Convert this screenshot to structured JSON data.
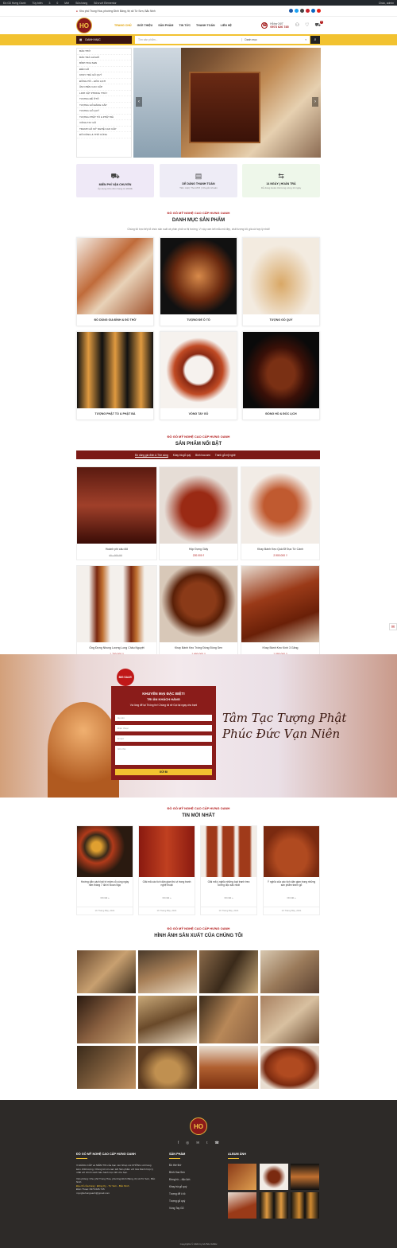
{
  "adminbar": {
    "items": [
      "Đồ Gỗ Hưng Oanh",
      "Tùy biến",
      "3",
      "0",
      "Mới",
      "Sửa trang",
      "Sửa với Elementor"
    ],
    "right": "Chào, admin"
  },
  "topbar": {
    "address": "Khu phố Trung Hòa, phường Đình Bảng, thị xã Từ Sơn, Bắc Ninh",
    "social_icons": [
      "facebook-icon",
      "twitter-icon",
      "email-icon",
      "pinterest-icon",
      "linkedin-icon",
      "youtube-icon"
    ]
  },
  "header": {
    "logo_text": "HO",
    "nav": [
      "TRANG CHỦ",
      "GIỚI THIỆU",
      "SẢN PHẨM",
      "TIN TỨC",
      "THANH TOÁN",
      "LIÊN HỆ"
    ],
    "hotline_label": "Hỗ trợ 24/7",
    "hotline_number": "0973 626 745",
    "cart_count": "0"
  },
  "search": {
    "category_label": "DANH MỤC",
    "placeholder": "Tìm sản phẩm...",
    "select_value": "Danh mục"
  },
  "categories": [
    "BÀN THỜ",
    "BÁN TRÀ GIÁ ĐỖ",
    "BÌNH HOA SEN",
    "ĐÈN GỖ",
    "KHAY TRÀ GỖ QUÝ",
    "ĐỒNG HỒ – ĐỒC LỊCH",
    "ÂM CHÉN CAO CẤP",
    "LINH VẬT PHONG THỦY",
    "TƯỢNG ĐỂ ÔTÔ",
    "TƯỢNG GỖ ĐĂNG CẤP",
    "TƯỢNG GỖ QUÝ",
    "TƯỢNG PHẬT TỔ & PHẬT BÀ",
    "VÒNG TAY GỖ",
    "TRANH GỖ MỸ NGHỆ CAO CẤP",
    "ĐỒ DÙNG & THỜ CÚNG"
  ],
  "features": [
    {
      "icon": "truck-icon",
      "title": "MIỄN PHÍ VẬN CHUYỂN",
      "sub": "Áp dụng Cho đơn hàng từ 2000k",
      "bg": "#efe9f7"
    },
    {
      "icon": "payment-icon",
      "title": "DỄ DÀNG THANH TOÁN",
      "sub": "Tiền mặt | Thẻ ATM | Chuyển khoản",
      "bg": "#eeecf6"
    },
    {
      "icon": "return-icon",
      "title": "14 NGÀY | HOÀN TRẢ",
      "sub": "Dễ dàng Hoàn trả trong vòng 14 ngày",
      "bg": "#eef7ea"
    }
  ],
  "categories_section": {
    "sub": "ĐỒ GỖ MỸ NGHỆ CAO CẤP HƯNG OANH",
    "title": "DANH MỤC SẢN PHẨM",
    "desc": "Chúng tôi trực tiếp tổ chức sản xuất và phân phối ra thị trường. Vì vậy cam kết mẫu mã đẹp, chất lượng tốt, giá cả hợp lý nhất!",
    "items": [
      "ĐỒ DÙNG GIA ĐÌNH & ĐỒ THỜ",
      "TƯỢNG ĐỂ Ô TÔ",
      "TƯỢNG GỖ QUÝ",
      "TƯỢNG PHẬT TỔ & PHẬT BÀ",
      "VÒNG TAY GỖ",
      "ĐỒNG HỒ & ĐỐC LỊCH"
    ]
  },
  "featured_section": {
    "sub": "ĐỒ GỖ MỸ NGHỆ CAO CẤP HƯNG OANH",
    "title": "SẢN PHẨM NỔI BẬT",
    "tabs": [
      "Đồ dùng gia đình & Thờ cúng",
      "Khay trà gỗ quý",
      "Bình hoa sen",
      "Tranh gỗ mỹ nghệ"
    ],
    "products": [
      {
        "name": "Hoành phi câu đối",
        "old": "46 - 991.98",
        "price": ""
      },
      {
        "name": "Hộp Đựng Giấy",
        "old": "",
        "price": "220.000 ₫"
      },
      {
        "name": "Khay Bánh Kẹo Quả Đỉ Đục Tứ Cánh",
        "old": "",
        "price": "2.900.000 ₫"
      },
      {
        "name": "Ống Đựng Nhung Lượng Long Châu Nguyệt",
        "old": "",
        "price": "1.700.000 ₫"
      },
      {
        "name": "Khay Bánh Kẹo Tròng Đồng Đồng Sen",
        "old": "",
        "price": "1.650.000 ₫"
      },
      {
        "name": "Khay Bánh Kẹo Kính 3 Găng",
        "old": "",
        "price": "1.050.000 ₫"
      }
    ]
  },
  "promo": {
    "badge": "BIG SALE!",
    "title1": "KHUYẾN MẠI ĐẶC BIỆT!",
    "title2": "TRI ÂN KHÁCH HÀNG",
    "desc": "Vui lòng để lại Thông tin! Chúng tôi sẽ Gọi lại ngay cho bạn!",
    "fields": [
      "Họ tên",
      "Điện thoại",
      "Email",
      "Ghi chú"
    ],
    "button": "GỬI ĐI",
    "calligraphy": "Tâm Tạc Tượng Phật Phúc Đức Vạn Niên"
  },
  "news_section": {
    "sub": "ĐỒ GỖ MỸ NGHỆ CAO CẤP HƯNG OANH",
    "title": "TIN MỚI NHẤT",
    "items": [
      {
        "title": "Hướng dẫn cách bài trí mâm cỗ cúng ngày rằm tháng 7 đà trí Đoan Ngọ",
        "more": "Chi tiết »",
        "date": "16 Tháng Bảy, 2021"
      },
      {
        "title": "Giải mã các tích dân gian thú vị trong tranh nghệ thuật",
        "more": "Chi tiết »",
        "date": "16 Tháng Bảy, 2021"
      },
      {
        "title": "Giải mã ý nghĩa những loại tranh treo tường độc sắc nhất",
        "more": "Chi tiết »",
        "date": "16 Tháng Bảy, 2021"
      },
      {
        "title": "Ý nghĩa của các tích dân gian trong những sản phẩm tranh gỗ",
        "more": "Chi tiết »",
        "date": "16 Tháng Bảy, 2021"
      }
    ]
  },
  "gallery_section": {
    "sub": "ĐỒ GỖ MỸ NGHỆ CAO CẤP HƯNG OANH",
    "title": "HÌNH ẢNH SẢN XUẤT CỦA CHÚNG TÔI"
  },
  "footer": {
    "logo_text": "HO",
    "about_title": "ĐỒ GỖ MỸ NGHỆ CAO CẤP HƯNG OANH",
    "about_text": "VI ĐẲNG CẤP và NIỀM TIN của bạn nên Shop nói KHÔNG với hàng kém chất lượng. Chúng tôi xin cam kết Sản phẩm với Giá thành hợp lý nhất với chính sách bảo hành trọn đời cho bạn.",
    "office": "Văn phòng: Khu phố Trung Hòa, phường Đình Bảng, thị xã Từ Sơn, Bắc Ninh",
    "store": "Địa chỉ cửa hàng : Đồng Kỵ - Từ Sơn - Bắc Ninh",
    "phone": "Điện Thoại: 0973.626.745",
    "email": "mynghehungoanh@gmail.com",
    "products_title": "SẢN PHẨM",
    "products": [
      "Đồ thờ thờ",
      "Bình Hoa Sen",
      "Đồng hồ – độc lịch",
      "Khay trà gỗ quý",
      "Tượng để ô tô",
      "Tượng gỗ quý",
      "Vòng Tay Gỗ"
    ],
    "album_title": "ALBUM ẢNH",
    "copyright": "Copyrights © 2021 by HƯNG OANH"
  }
}
